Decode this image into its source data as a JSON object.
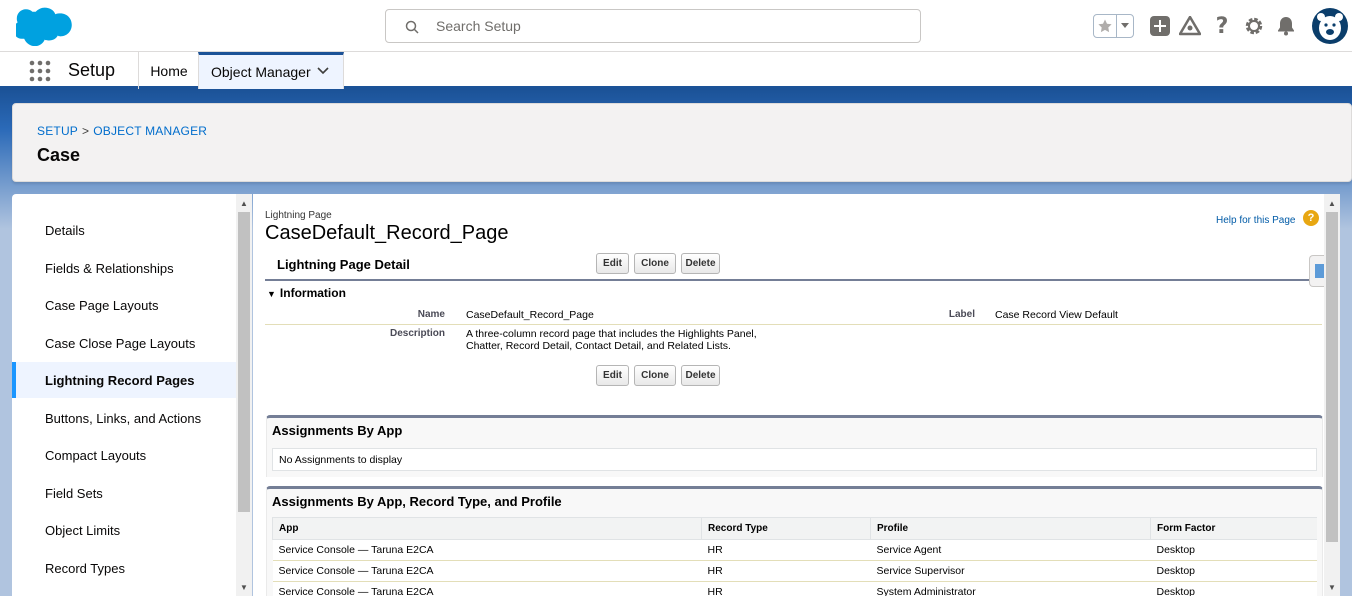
{
  "header": {
    "search_placeholder": "Search Setup"
  },
  "icons": {
    "logo": "salesforce-cloud-icon",
    "search": "search-icon",
    "favorite": "star-icon",
    "favorites_dropdown": "chevron-down-icon",
    "global_actions": "plus-icon",
    "trailhead": "trailhead-icon",
    "help": "question-icon",
    "setup": "gear-icon",
    "notifications": "bell-icon",
    "avatar": "avatar"
  },
  "context_bar": {
    "app_name": "Setup",
    "tabs": [
      {
        "label": "Home"
      },
      {
        "label": "Object Manager"
      }
    ]
  },
  "page_header": {
    "breadcrumb_setup": "SETUP",
    "breadcrumb_sep": ">",
    "breadcrumb_object_manager": "OBJECT MANAGER",
    "title": "Case"
  },
  "left_nav": {
    "items": [
      {
        "label": "Details"
      },
      {
        "label": "Fields & Relationships"
      },
      {
        "label": "Case Page Layouts"
      },
      {
        "label": "Case Close Page Layouts"
      },
      {
        "label": "Lightning Record Pages"
      },
      {
        "label": "Buttons, Links, and Actions"
      },
      {
        "label": "Compact Layouts"
      },
      {
        "label": "Field Sets"
      },
      {
        "label": "Object Limits"
      },
      {
        "label": "Record Types"
      }
    ],
    "active_index": 4
  },
  "main": {
    "type_label": "Lightning Page",
    "record_name": "CaseDefault_Record_Page",
    "help_link": "Help for this Page",
    "help_icon_glyph": "?",
    "detail_title": "Lightning Page Detail",
    "buttons": {
      "edit": "Edit",
      "clone": "Clone",
      "delete": "Delete"
    },
    "section_title": "Information",
    "fields": {
      "name_label": "Name",
      "name_value": "CaseDefault_Record_Page",
      "label_label": "Label",
      "label_value": "Case Record View Default",
      "description_label": "Description",
      "description_line1": "A three-column record page that includes the Highlights Panel,",
      "description_line2": "Chatter, Record Detail, Contact Detail, and Related Lists."
    },
    "assignments_by_app": {
      "title": "Assignments By App",
      "empty_text": "No Assignments to display"
    },
    "assignments_full": {
      "title": "Assignments By App, Record Type, and Profile",
      "columns": [
        "App",
        "Record Type",
        "Profile",
        "Form Factor"
      ],
      "rows": [
        [
          "Service Console — Taruna E2CA",
          "HR",
          "Service Agent",
          "Desktop"
        ],
        [
          "Service Console — Taruna E2CA",
          "HR",
          "Service Supervisor",
          "Desktop"
        ],
        [
          "Service Console — Taruna E2CA",
          "HR",
          "System Administrator",
          "Desktop"
        ]
      ]
    }
  }
}
